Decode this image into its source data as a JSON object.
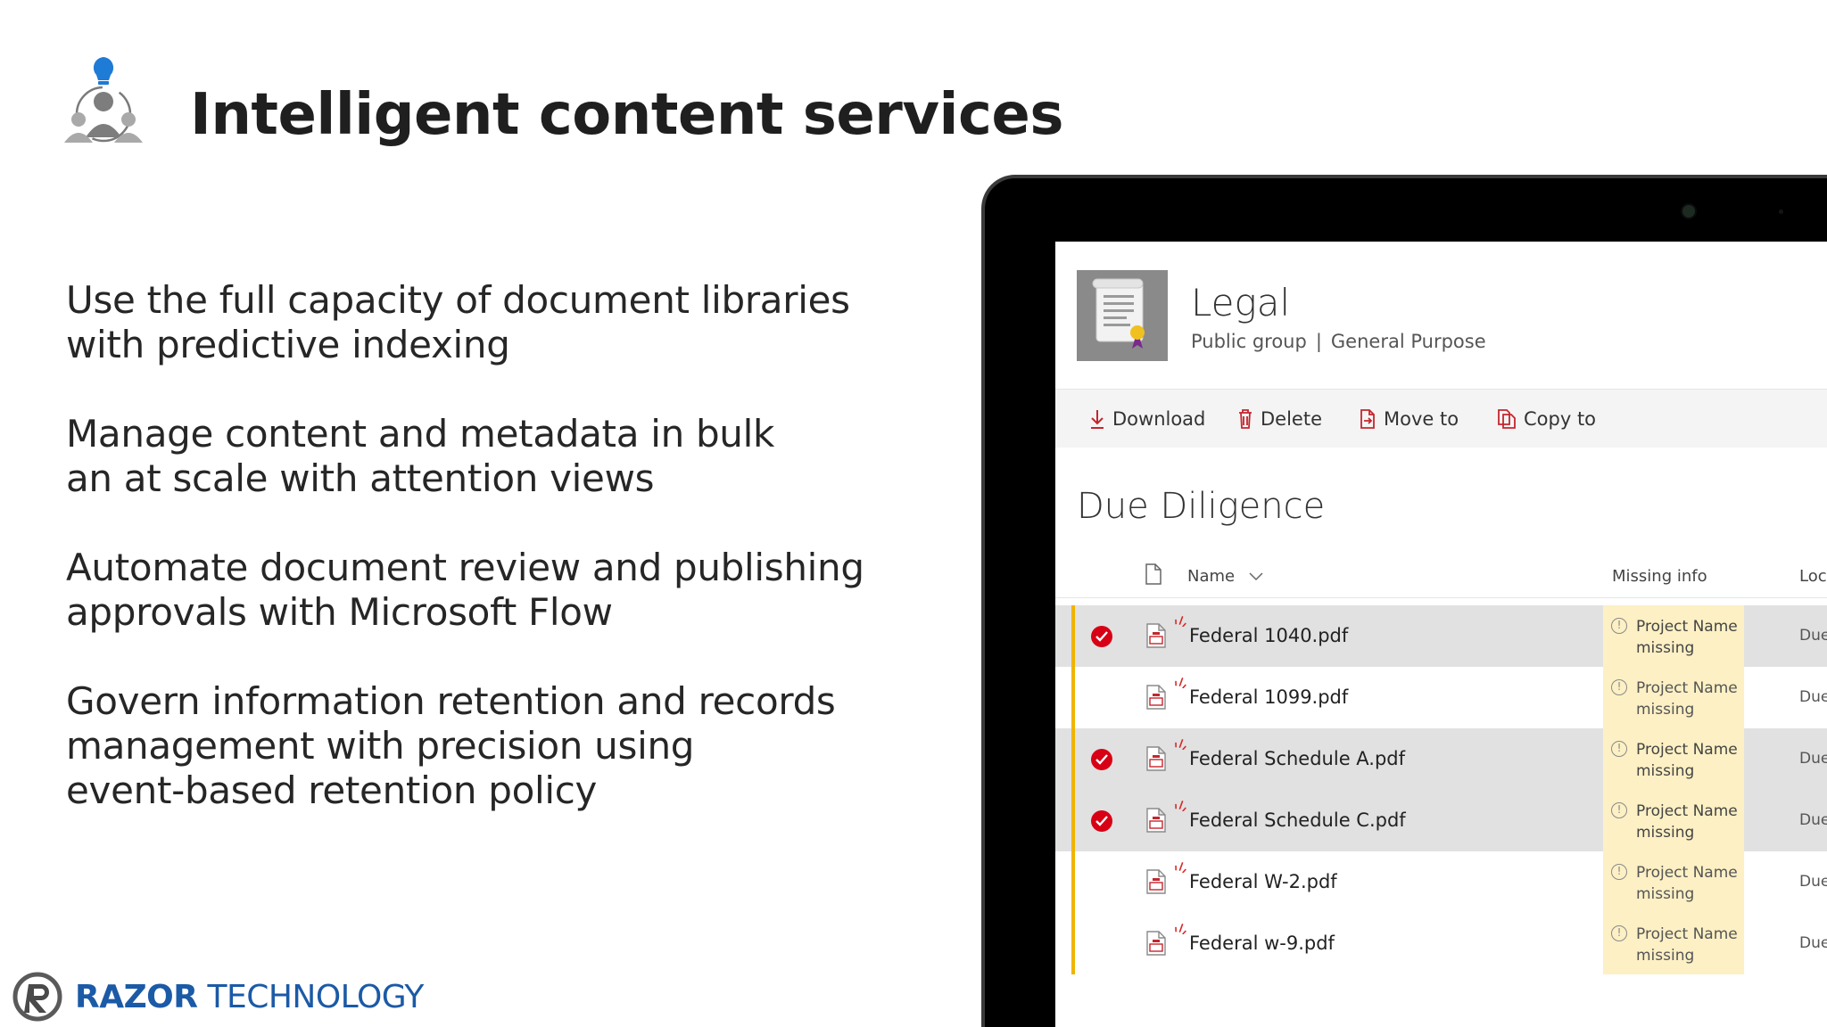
{
  "slide": {
    "title": "Intelligent content services",
    "bullets": [
      {
        "lines": [
          "Use the full capacity of document libraries",
          "with predictive indexing"
        ]
      },
      {
        "lines": [
          "Manage content and metadata in bulk",
          "an at scale with attention views"
        ]
      },
      {
        "lines": [
          "Automate document review and publishing",
          "approvals with Microsoft Flow"
        ]
      },
      {
        "lines": [
          "Govern information retention and records",
          "management with precision using",
          "event-based retention policy"
        ]
      }
    ]
  },
  "brand": {
    "name_bold": "RAZOR",
    "name_light": " TECHNOLOGY",
    "color": "#1b5aa6"
  },
  "site": {
    "title": "Legal",
    "privacy": "Public group",
    "separator": "|",
    "classification": "General Purpose"
  },
  "commands": [
    {
      "label": "Download",
      "icon": "download-icon"
    },
    {
      "label": "Delete",
      "icon": "trash-icon"
    },
    {
      "label": "Move to",
      "icon": "move-icon"
    },
    {
      "label": "Copy to",
      "icon": "copy-icon"
    }
  ],
  "library": {
    "title": "Due Diligence",
    "columns": {
      "name": "Name",
      "missing": "Missing info",
      "location": "Loca"
    },
    "rows": [
      {
        "name": "Federal 1040.pdf",
        "selected": true,
        "missing": [
          "Project Name",
          "missing"
        ],
        "location": "Due"
      },
      {
        "name": "Federal 1099.pdf",
        "selected": false,
        "missing": [
          "Project Name",
          "missing"
        ],
        "location": "Due"
      },
      {
        "name": "Federal Schedule A.pdf",
        "selected": true,
        "missing": [
          "Project Name",
          "missing"
        ],
        "location": "Due"
      },
      {
        "name": "Federal Schedule C.pdf",
        "selected": true,
        "missing": [
          "Project Name",
          "missing"
        ],
        "location": "Due"
      },
      {
        "name": "Federal W-2.pdf",
        "selected": false,
        "missing": [
          "Project Name",
          "missing"
        ],
        "location": "Due"
      },
      {
        "name": "Federal w-9.pdf",
        "selected": false,
        "missing": [
          "Project Name",
          "missing"
        ],
        "location": "Due"
      }
    ]
  },
  "colors": {
    "accent_bar": "#f0b400",
    "check_red": "#d70015",
    "missing_bg": "#fcf0c4",
    "selected_row": "#e1e1e1"
  }
}
